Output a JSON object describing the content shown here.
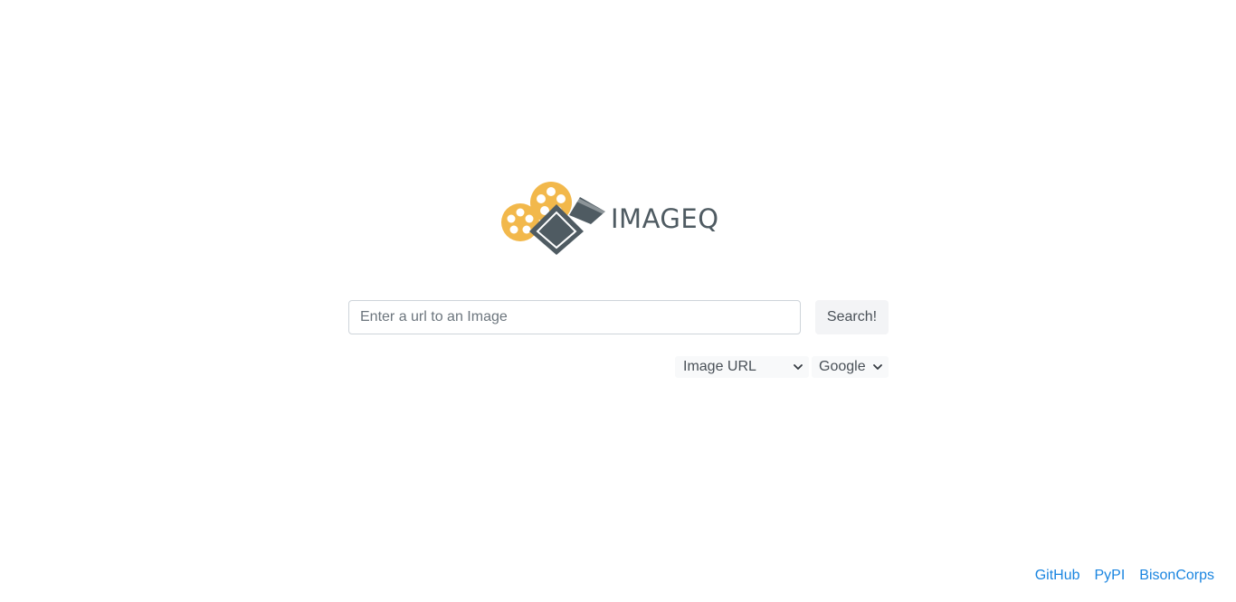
{
  "logo": {
    "text": "IMAGEQ",
    "icon": "film-camera-icon",
    "colors": {
      "reel": "#f2b84b",
      "body": "#4f5b62"
    }
  },
  "search": {
    "placeholder": "Enter a url to an Image",
    "value": "",
    "button_label": "Search!"
  },
  "options": {
    "input_type": {
      "selected": "Image URL",
      "icon": "chevron-down-icon"
    },
    "engine": {
      "selected": "Google",
      "icon": "chevron-down-icon"
    }
  },
  "footer": {
    "links": [
      "GitHub",
      "PyPI",
      "BisonCorps"
    ],
    "link_color": "#1a85e0"
  }
}
